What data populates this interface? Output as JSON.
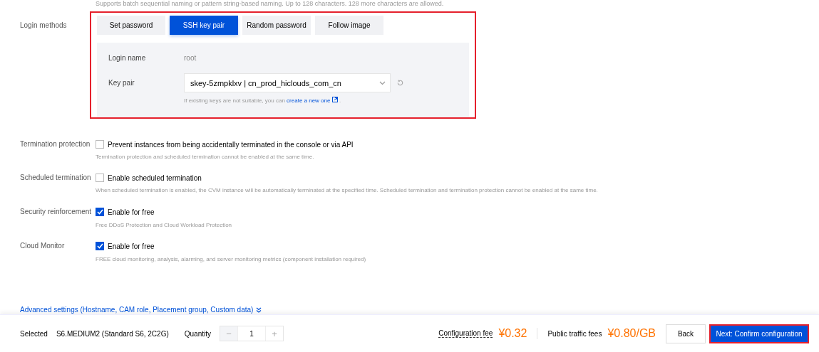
{
  "top_hint": "Supports batch sequential naming or pattern string-based naming. Up to 128 characters. 128 more characters are allowed.",
  "login": {
    "label": "Login methods",
    "highlighted": true,
    "tabs": [
      {
        "label": "Set password",
        "selected": false
      },
      {
        "label": "SSH key pair",
        "selected": true
      },
      {
        "label": "Random password",
        "selected": false
      },
      {
        "label": "Follow image",
        "selected": false
      }
    ],
    "login_name": {
      "label": "Login name",
      "value": "root"
    },
    "key_pair": {
      "label": "Key pair",
      "value": "skey-5zmpklxv | cn_prod_hiclouds_com_cn",
      "hint": "If existing keys are not suitable, you can",
      "link": "create a new one",
      "after": "."
    }
  },
  "options": [
    {
      "label": "Termination protection",
      "text": "Prevent instances from being accidentally terminated in the console or via API",
      "checked": false,
      "hint": "Termination protection and scheduled termination cannot be enabled at the same time."
    },
    {
      "label": "Scheduled termination",
      "text": "Enable scheduled termination",
      "checked": false,
      "hint": "When scheduled termination is enabled, the CVM instance will be automatically terminated at the specified time. Scheduled termination and termination protection cannot be enabled at the same time."
    },
    {
      "label": "Security reinforcement",
      "text": "Enable for free",
      "checked": true,
      "hint": "Free DDoS Protection and Cloud Workload Protection"
    },
    {
      "label": "Cloud Monitor",
      "text": "Enable for free",
      "checked": true,
      "hint": "FREE cloud monitoring, analysis, alarming, and server monitoring metrics (component installation required)"
    }
  ],
  "advanced_link": "Advanced settings (Hostname,  CAM role,  Placement group,  Custom data)",
  "footer": {
    "selected_label": "Selected",
    "selected_value": "S6.MEDIUM2 (Standard S6, 2C2G)",
    "quantity_label": "Quantity",
    "minus": "−",
    "quantity": "1",
    "plus": "+",
    "config_fee_label": "Configuration fee",
    "config_fee": "¥0.32",
    "traffic_label": "Public traffic fees",
    "traffic_fee": "¥0.80/GB",
    "back": "Back",
    "next": "Next: Confirm configuration",
    "next_highlighted": true
  }
}
